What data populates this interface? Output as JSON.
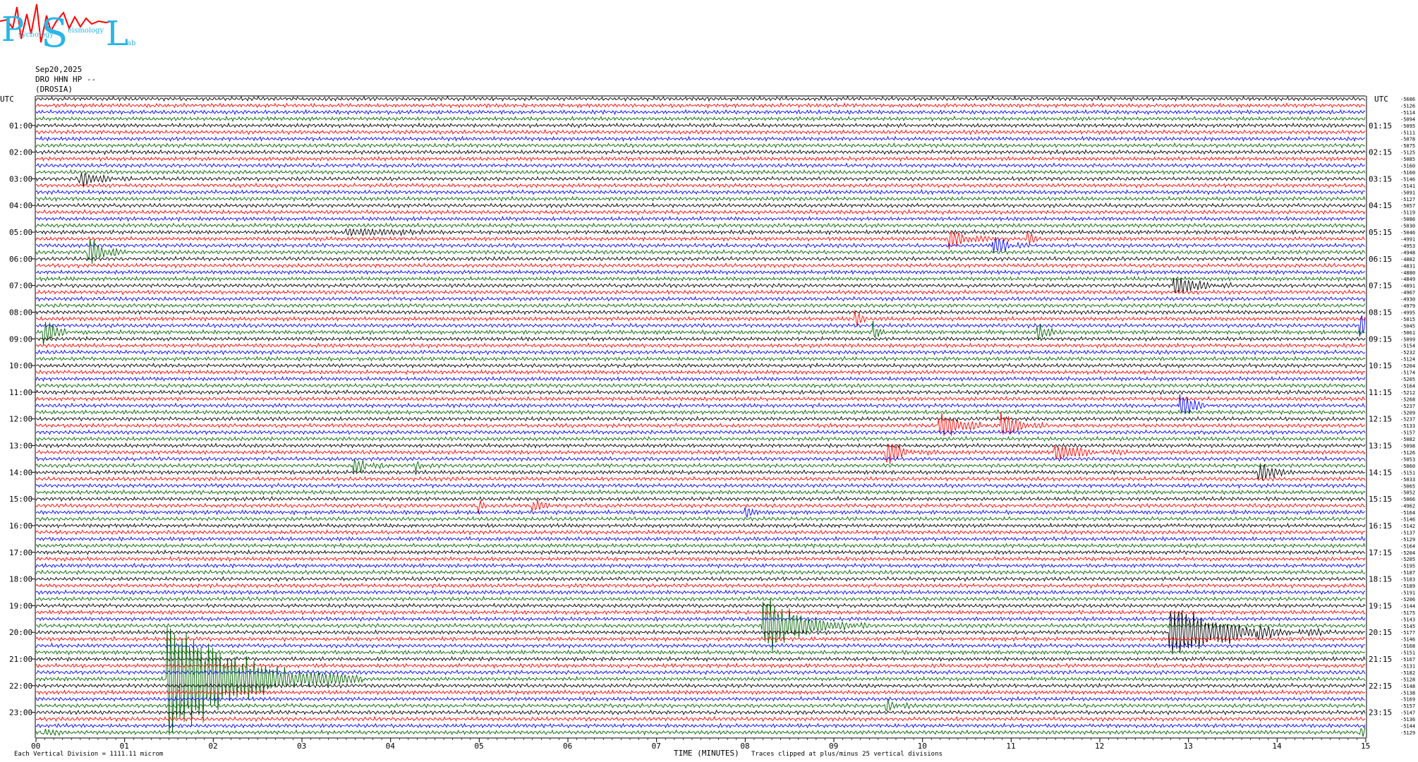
{
  "logo": {
    "letters": [
      "P",
      "S",
      "L"
    ],
    "small_text": [
      "sychology",
      "eismology",
      "ab"
    ],
    "letter_color": "#29b6e8",
    "wave_color": "#ff0000"
  },
  "header": {
    "date": "Sep20,2025",
    "channel": "DRO HHN HP --",
    "station": "(DROSIA)"
  },
  "axes": {
    "left_unit": "UTC",
    "right_unit": "UTC",
    "left_ticks": [
      "01:00",
      "02:00",
      "03:00",
      "04:00",
      "05:00",
      "06:00",
      "07:00",
      "08:00",
      "09:00",
      "10:00",
      "11:00",
      "12:00",
      "13:00",
      "14:00",
      "15:00",
      "16:00",
      "17:00",
      "18:00",
      "19:00",
      "20:00",
      "21:00",
      "22:00",
      "23:00"
    ],
    "right_ticks": [
      "01:15",
      "02:15",
      "03:15",
      "04:15",
      "05:15",
      "06:15",
      "07:15",
      "08:15",
      "09:15",
      "10:15",
      "11:15",
      "12:15",
      "13:15",
      "14:15",
      "15:15",
      "16:15",
      "17:15",
      "18:15",
      "19:15",
      "20:15",
      "21:15",
      "22:15",
      "23:15"
    ],
    "x_ticks": [
      "00",
      "01",
      "02",
      "03",
      "04",
      "05",
      "06",
      "07",
      "08",
      "09",
      "10",
      "11",
      "12",
      "13",
      "14",
      "15"
    ],
    "x_label": "TIME (MINUTES)"
  },
  "footer": {
    "left_note": "Each Vertical Division = 1111.11 microm",
    "right_note": "Traces clipped at plus/minus 25 vertical divisions"
  },
  "colors": {
    "cycle": [
      "#000000",
      "#ff0000",
      "#0000ff",
      "#006400"
    ]
  },
  "chart_data": {
    "type": "line",
    "minutes_per_line": 15,
    "lines_count": 96,
    "trace_color_cycle": [
      "black",
      "red",
      "blue",
      "green"
    ],
    "xlim": [
      0,
      15
    ],
    "right_labels": [
      "-5686",
      "-5126",
      "-5114",
      "-5094",
      "-5095",
      "-5111",
      "-5078",
      "-5075",
      "-5125",
      "-5085",
      "-5160",
      "-5160",
      "-5146",
      "-5141",
      "-5091",
      "-5127",
      "-5057",
      "-5119",
      "-5086",
      "-5030",
      "-5046",
      "-4991",
      "-4953",
      "-4948",
      "-4882",
      "-4831",
      "-4880",
      "-4849",
      "-4891",
      "-4967",
      "-4930",
      "-4979",
      "-4995",
      "-5015",
      "-5045",
      "-5061",
      "-5099",
      "-5154",
      "-5232",
      "-5124",
      "-5204",
      "-5174",
      "-5205",
      "-5164",
      "-5212",
      "-5268",
      "-5237",
      "-5209",
      "-5237",
      "-5133",
      "-5157",
      "-5082",
      "-5098",
      "-5126",
      "-5053",
      "-5060",
      "-5151",
      "-5033",
      "-5065",
      "-5052",
      "-5066",
      "-4962",
      "-5164",
      "-5146",
      "-5142",
      "-5137",
      "-5129",
      "-5164",
      "-5204",
      "-5205",
      "-5195",
      "-5187",
      "-5183",
      "-5189",
      "-5191",
      "-5206",
      "-5144",
      "-5175",
      "-5143",
      "-5145",
      "-5177",
      "-5146",
      "-5168",
      "-5151",
      "-5167",
      "-5131",
      "-5182",
      "-5128",
      "-5148",
      "-5138",
      "-5169",
      "-5157",
      "-5147",
      "-5136",
      "-5144",
      "-5129"
    ],
    "events": [
      {
        "line": 12,
        "minute": 0.5,
        "amplitude": 10,
        "duration": 0.8
      },
      {
        "line": 20,
        "minute": 3.5,
        "amplitude": 5,
        "duration": 1.8
      },
      {
        "line": 23,
        "minute": 0.6,
        "amplitude": 22,
        "duration": 0.5
      },
      {
        "line": 21,
        "minute": 10.3,
        "amplitude": 16,
        "duration": 0.6
      },
      {
        "line": 22,
        "minute": 10.8,
        "amplitude": 14,
        "duration": 0.5
      },
      {
        "line": 21,
        "minute": 11.2,
        "amplitude": 12,
        "duration": 0.15
      },
      {
        "line": 28,
        "minute": 12.85,
        "amplitude": 18,
        "duration": 0.7
      },
      {
        "line": 33,
        "minute": 9.25,
        "amplitude": 12,
        "duration": 0.2
      },
      {
        "line": 35,
        "minute": 9.45,
        "amplitude": 14,
        "duration": 0.15
      },
      {
        "line": 35,
        "minute": 11.3,
        "amplitude": 10,
        "duration": 0.4
      },
      {
        "line": 34,
        "minute": 14.95,
        "amplitude": 18,
        "duration": 0.3
      },
      {
        "line": 35,
        "minute": 0.1,
        "amplitude": 20,
        "duration": 0.4
      },
      {
        "line": 46,
        "minute": 12.9,
        "amplitude": 24,
        "duration": 0.4
      },
      {
        "line": 49,
        "minute": 10.2,
        "amplitude": 18,
        "duration": 0.8
      },
      {
        "line": 49,
        "minute": 10.9,
        "amplitude": 22,
        "duration": 0.5
      },
      {
        "line": 53,
        "minute": 9.6,
        "amplitude": 16,
        "duration": 0.6
      },
      {
        "line": 53,
        "minute": 11.5,
        "amplitude": 14,
        "duration": 0.9
      },
      {
        "line": 55,
        "minute": 3.6,
        "amplitude": 10,
        "duration": 0.5
      },
      {
        "line": 55,
        "minute": 4.3,
        "amplitude": 6,
        "duration": 0.3
      },
      {
        "line": 56,
        "minute": 13.8,
        "amplitude": 14,
        "duration": 0.6
      },
      {
        "line": 61,
        "minute": 5.6,
        "amplitude": 10,
        "duration": 0.4
      },
      {
        "line": 61,
        "minute": 5.0,
        "amplitude": 12,
        "duration": 0.1
      },
      {
        "line": 62,
        "minute": 8.0,
        "amplitude": 10,
        "duration": 0.3
      },
      {
        "line": 79,
        "minute": 8.2,
        "amplitude": 45,
        "duration": 1.2
      },
      {
        "line": 80,
        "minute": 12.8,
        "amplitude": 40,
        "duration": 1.8
      },
      {
        "line": 80,
        "minute": 13.8,
        "amplitude": 16,
        "duration": 0.4
      },
      {
        "line": 87,
        "minute": 1.5,
        "amplitude": 90,
        "duration": 2.2
      },
      {
        "line": 91,
        "minute": 9.6,
        "amplitude": 8,
        "duration": 0.5
      },
      {
        "line": 95,
        "minute": 14.95,
        "amplitude": 8,
        "duration": 0.3
      },
      {
        "line": 95,
        "minute": 0.1,
        "amplitude": 6,
        "duration": 0.4
      }
    ]
  }
}
